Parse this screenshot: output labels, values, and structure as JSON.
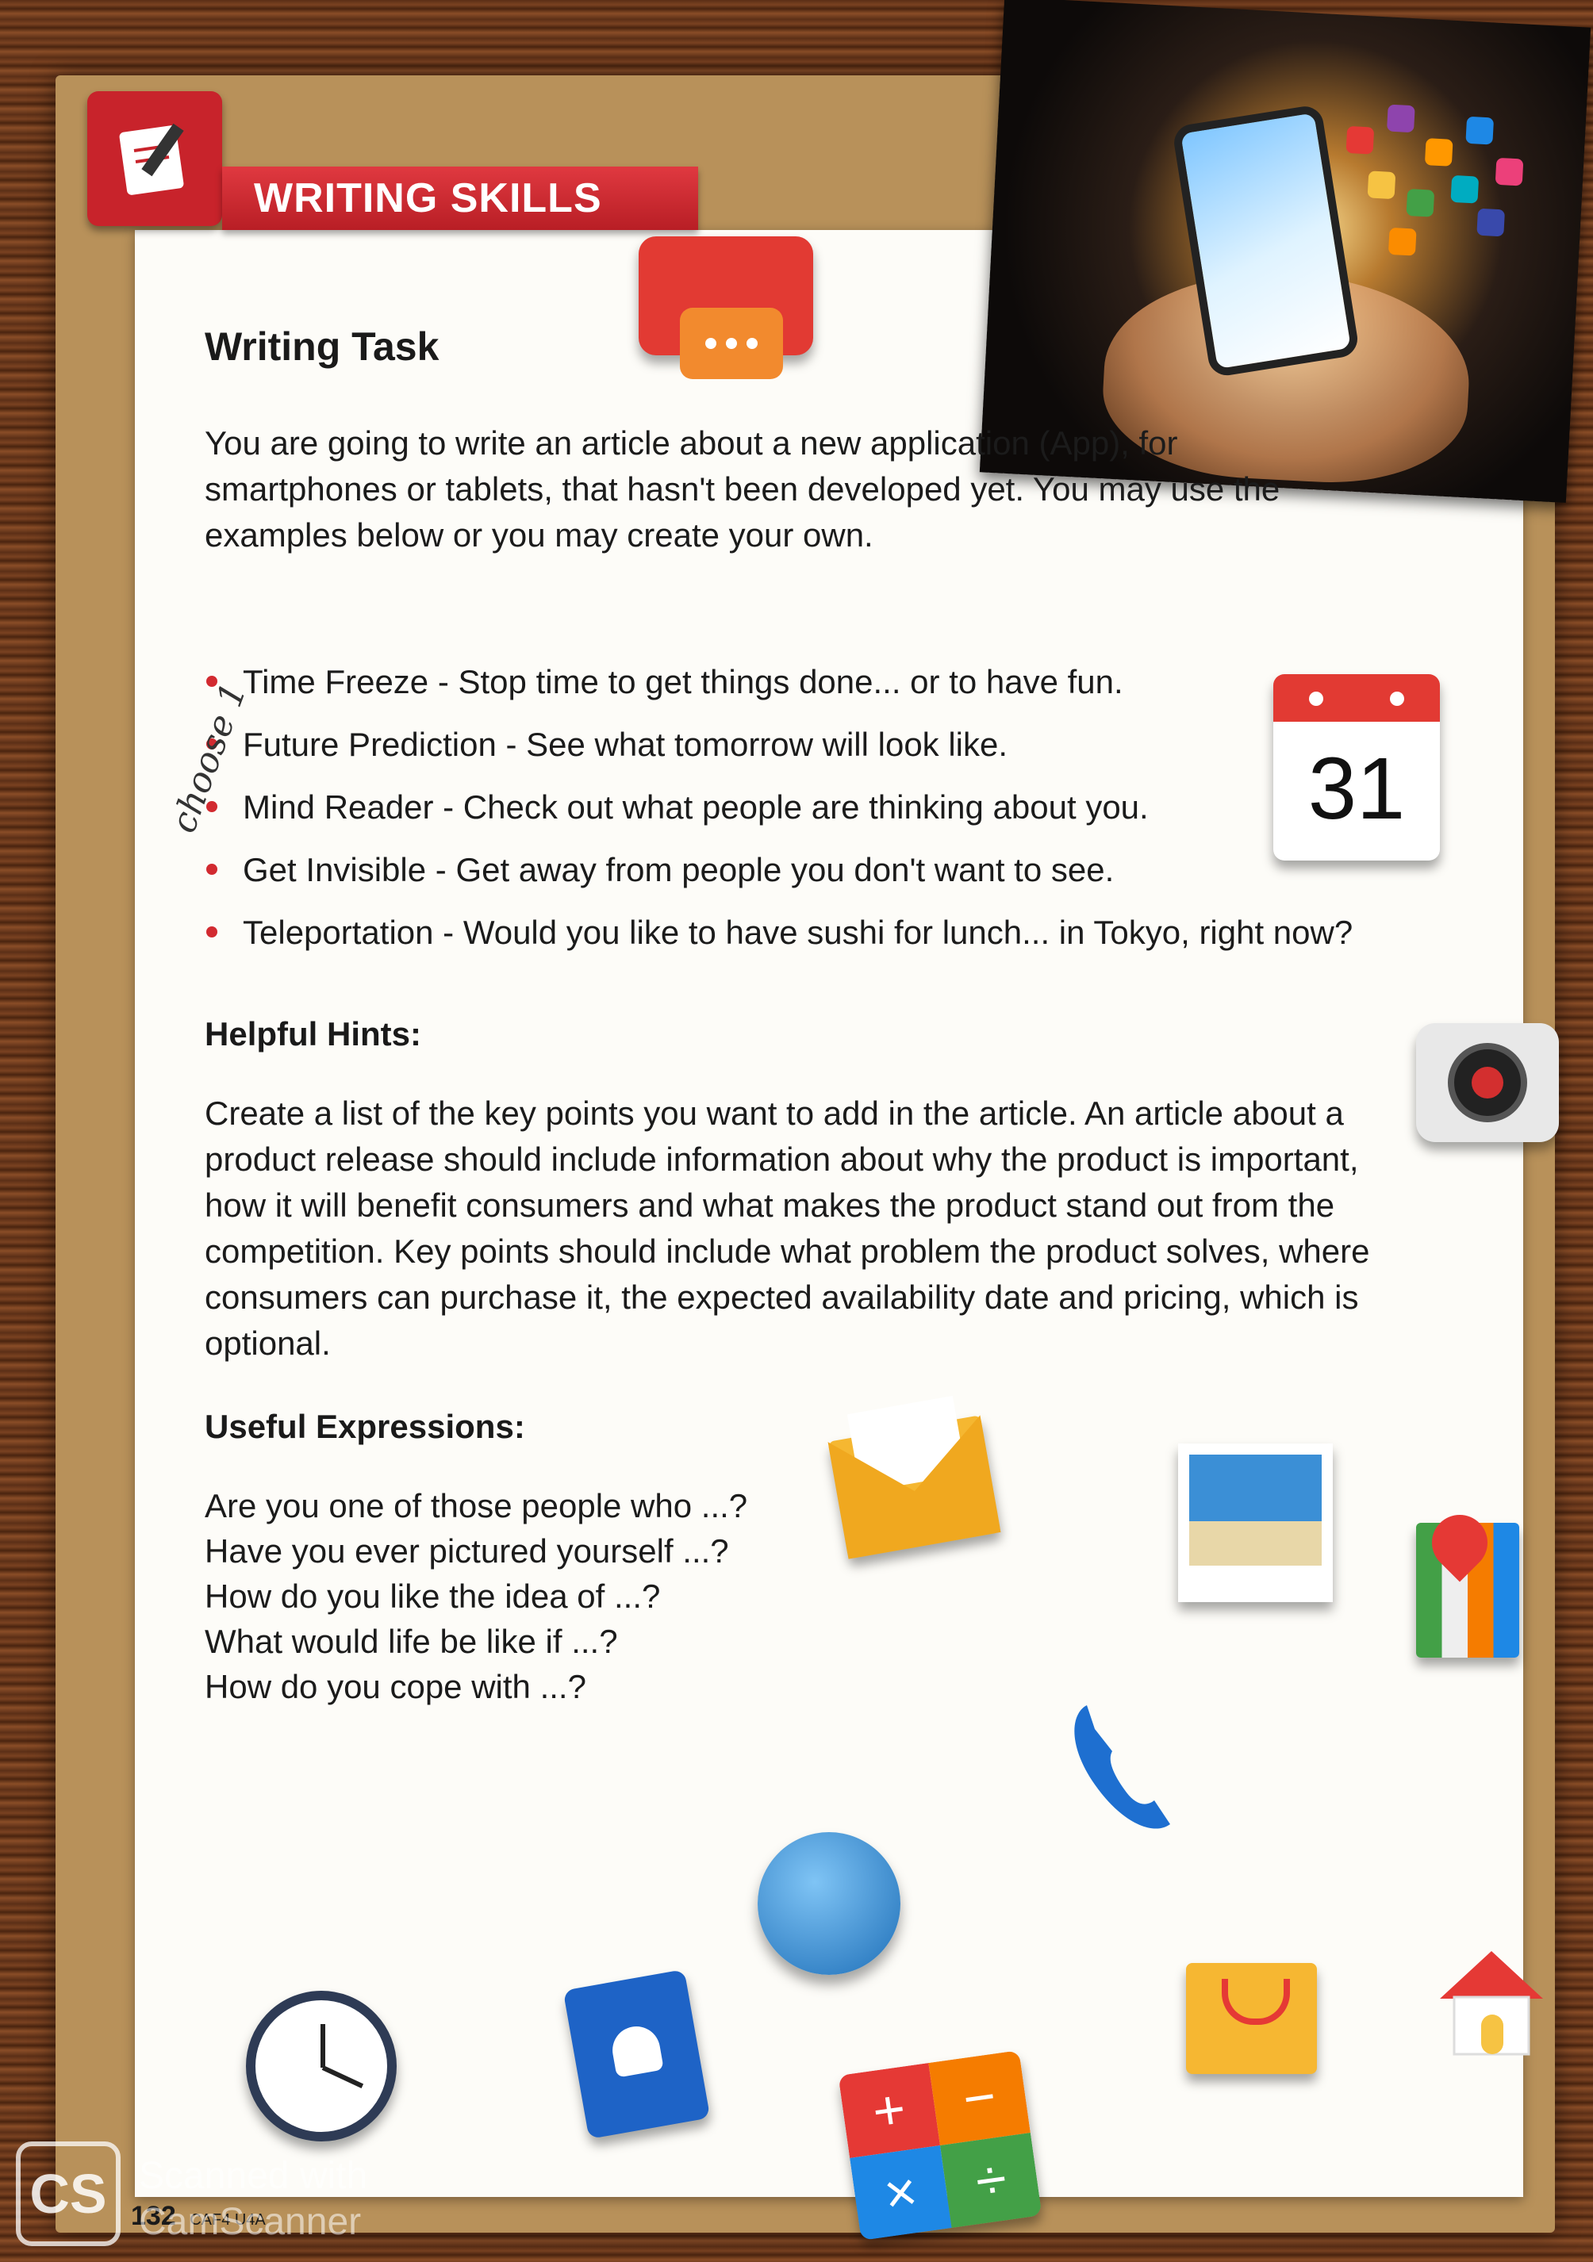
{
  "header": {
    "banner_label": "WRITING SKILLS"
  },
  "task": {
    "title": "Writing Task",
    "intro": "You are going to write an article about a new application (App), for smartphones or tablets, that hasn't been developed yet. You may use the examples below or you may create your own."
  },
  "ideas": [
    {
      "name": "Time Freeze",
      "desc": "Stop time to get things done... or to have fun."
    },
    {
      "name": "Future Prediction",
      "desc": "See what tomorrow will look like."
    },
    {
      "name": "Mind Reader",
      "desc": "Check out what people are thinking about you."
    },
    {
      "name": "Get Invisible",
      "desc": "Get away from people you don't want to see."
    },
    {
      "name": "Teleportation",
      "desc": "Would you like to have sushi for lunch... in Tokyo, right now?"
    }
  ],
  "handwritten_note": "choose 1",
  "calendar": {
    "day": "31"
  },
  "hints": {
    "heading": "Helpful Hints:",
    "text": "Create a list of the key points you want to add in the article. An article about a product release should include information about why the product is important, how it will benefit consumers and what makes the product stand out from the competition. Key points should include what problem the product solves, where consumers can purchase it, the expected availability date and pricing, which is optional."
  },
  "expressions": {
    "heading": "Useful Expressions:",
    "items": [
      "Are you one of those people who ...?",
      "Have you ever pictured yourself ...?",
      "How do you like the idea of ...?",
      "What would life be like if ...?",
      "How do you cope with ...?"
    ]
  },
  "footer": {
    "page_number": "132",
    "code": "CAF4 U4A"
  },
  "watermark": {
    "logo": "CS",
    "text": "Scanned with CamScanner"
  },
  "colors": {
    "accent_red": "#d22a30",
    "board": "#b8915a",
    "paper": "#fdfcf8"
  }
}
